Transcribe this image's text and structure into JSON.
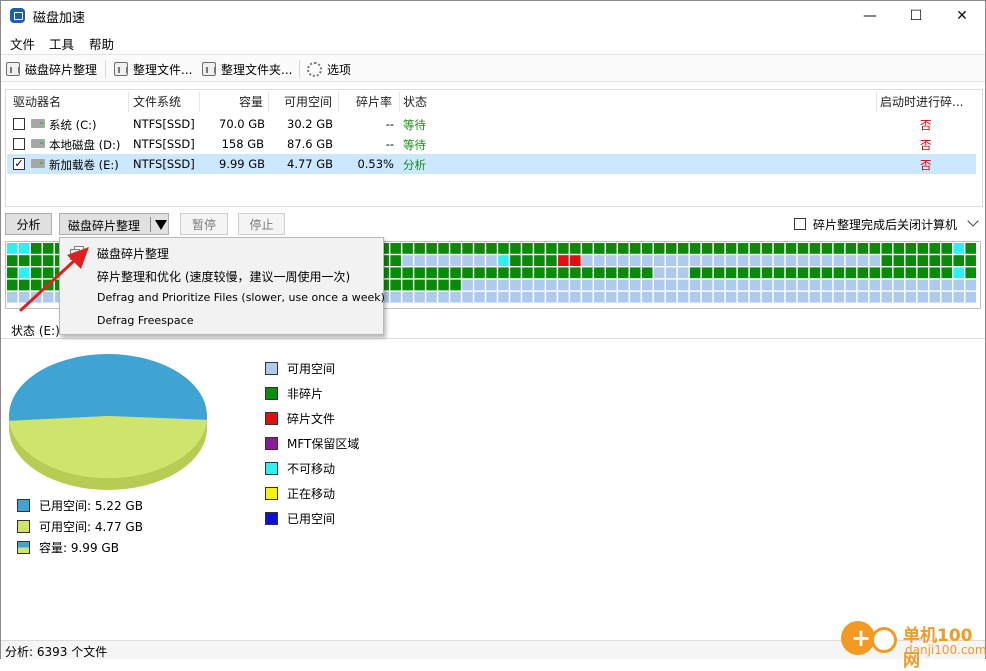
{
  "window": {
    "title": "磁盘加速",
    "min_glyph": "—",
    "max_glyph": "☐",
    "close_glyph": "✕"
  },
  "menu": [
    "文件",
    "工具",
    "帮助"
  ],
  "toolbar": {
    "defrag": "磁盘碎片整理",
    "defrag_file": "整理文件...",
    "defrag_folder": "整理文件夹...",
    "options": "选项"
  },
  "table": {
    "headers": {
      "drive": "驱动器名",
      "fs": "文件系统",
      "capacity": "容量",
      "free": "可用空间",
      "frag": "碎片率",
      "status": "状态",
      "boot": "启动时进行碎..."
    },
    "rows": [
      {
        "checked": false,
        "name": "系统 (C:)",
        "fs": "NTFS[SSD]",
        "capacity": "70.0 GB",
        "free": "30.2 GB",
        "frag": "--",
        "status": "等待",
        "boot": "否"
      },
      {
        "checked": false,
        "name": "本地磁盘 (D:)",
        "fs": "NTFS[SSD]",
        "capacity": "158 GB",
        "free": "87.6 GB",
        "frag": "--",
        "status": "等待",
        "boot": "否"
      },
      {
        "checked": true,
        "name": "新加载卷 (E:)",
        "fs": "NTFS[SSD]",
        "capacity": "9.99 GB",
        "free": "4.77 GB",
        "frag": "0.53%",
        "status": "分析",
        "boot": "否"
      }
    ]
  },
  "actions": {
    "analyze": "分析",
    "defrag_split": "磁盘碎片整理",
    "pause": "暂停",
    "stop": "停止",
    "shutdown_label": "碎片整理完成后关闭计算机"
  },
  "dropdown": [
    "磁盘碎片整理",
    "碎片整理和优化 (速度较慢，建议一周使用一次)",
    "Defrag and Prioritize Files (slower, use once a week)",
    "Defrag Freespace"
  ],
  "status_tab": "状态 (E:)",
  "colors": {
    "free": "#aecbeb",
    "nonfrag": "#0a8a0a",
    "frag": "#e01010",
    "mft": "#8a1a9a",
    "unmovable": "#2ef0f0",
    "moving": "#f6f20e",
    "used_blue": "#1010d0",
    "pie_used": "#3fa3d4",
    "pie_free": "#cfe46a",
    "selection": "#cce8ff",
    "watermark": "#f39a24"
  },
  "chart_data": {
    "type": "pie",
    "slices": [
      {
        "label": "已用空间",
        "value": 5.22,
        "unit": "GB"
      },
      {
        "label": "可用空间",
        "value": 4.77,
        "unit": "GB"
      }
    ],
    "total": {
      "label": "容量",
      "value": 9.99,
      "unit": "GB"
    }
  },
  "pie_legend": [
    {
      "text": "已用空间: 5.22 GB",
      "color": "#3fa3d4"
    },
    {
      "text": "可用空间: 4.77 GB",
      "color": "#cfe46a"
    },
    {
      "text": "容量: 9.99 GB",
      "color": "split"
    }
  ],
  "map_legend": [
    {
      "text": "可用空间",
      "color": "#aecbeb"
    },
    {
      "text": "非碎片",
      "color": "#0a8a0a"
    },
    {
      "text": "碎片文件",
      "color": "#e01010"
    },
    {
      "text": "MFT保留区域",
      "color": "#8a1a9a"
    },
    {
      "text": "不可移动",
      "color": "#2ef0f0"
    },
    {
      "text": "正在移动",
      "color": "#f6f20e"
    },
    {
      "text": "已用空间",
      "color": "#1010d0"
    }
  ],
  "statusbar": "分析: 6393 个文件",
  "watermark": {
    "line1": "单机100网",
    "line2": "danji100.com"
  }
}
